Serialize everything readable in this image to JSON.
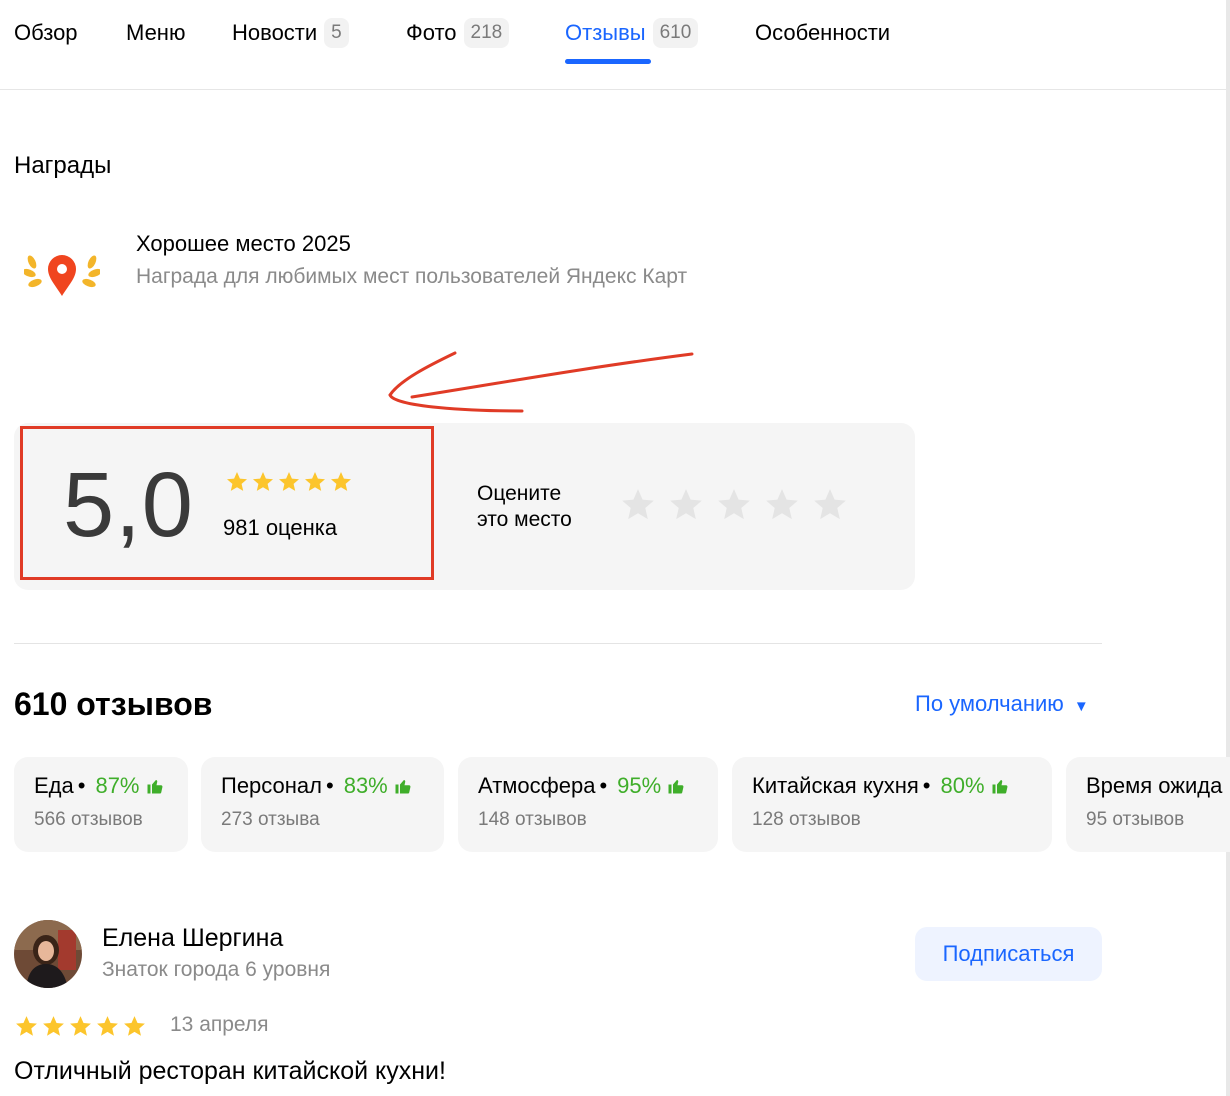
{
  "tabs": [
    {
      "label": "Обзор",
      "count": null
    },
    {
      "label": "Меню",
      "count": null
    },
    {
      "label": "Новости",
      "count": "5"
    },
    {
      "label": "Фото",
      "count": "218"
    },
    {
      "label": "Отзывы",
      "count": "610"
    },
    {
      "label": "Особенности",
      "count": null
    }
  ],
  "active_tab": "Отзывы",
  "awards": {
    "heading": "Награды",
    "item": {
      "title": "Хорошее место 2025",
      "subtitle": "Награда для любимых мест пользователей Яндекс Карт",
      "icon": "laurel-map-pin-icon"
    }
  },
  "rating": {
    "value": "5,0",
    "stars": 5,
    "count_label": "981 оценка",
    "rate_prompt_line1": "Оцените",
    "rate_prompt_line2": "это место",
    "user_stars": 0
  },
  "reviews": {
    "title": "610 отзывов",
    "sort_label": "По умолчанию",
    "aspects": [
      {
        "name": "Еда",
        "percent": "87%",
        "count": "566 отзывов"
      },
      {
        "name": "Персонал",
        "percent": "83%",
        "count": "273 отзыва"
      },
      {
        "name": "Атмосфера",
        "percent": "95%",
        "count": "148 отзывов"
      },
      {
        "name": "Китайская кухня",
        "percent": "80%",
        "count": "128 отзывов"
      },
      {
        "name": "Время ожида",
        "percent": "",
        "count": "95 отзывов"
      }
    ],
    "first_review": {
      "author": "Елена Шергина",
      "level": "Знаток города 6 уровня",
      "subscribe_label": "Подписаться",
      "stars": 5,
      "date": "13 апреля",
      "text": "Отличный ресторан китайской кухни!"
    }
  },
  "colors": {
    "accent": "#1a66ff",
    "star": "#fcc52c",
    "positive": "#3fae2a",
    "highlight": "#e03b26"
  }
}
